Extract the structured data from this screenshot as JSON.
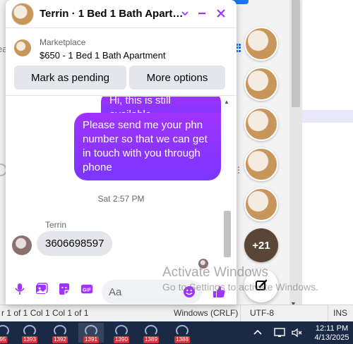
{
  "chat": {
    "title": "Terrin · 1 Bed 1 Bath Apart…",
    "listing": {
      "category": "Marketplace",
      "title": "$650 - 1 Bed 1 Bath Apartment"
    },
    "actions": {
      "mark_pending": "Mark as pending",
      "more_options": "More options"
    },
    "messages": {
      "outgoing_partial": "Hi, this is still available",
      "outgoing": "Please send me your phn number so that we can get in touch with you through phone",
      "timestamp": "Sat 2:57 PM",
      "sender": "Terrin",
      "incoming": "3606698597"
    },
    "composer": {
      "placeholder": "Aa"
    }
  },
  "sidebar": {
    "more_count": "+21"
  },
  "background": {
    "left_text": "ea"
  },
  "statusbar": {
    "left": "r 1 of 1 Col 1 Col 1 of 1",
    "encoding": "Windows (CRLF)",
    "utf": "UTF-8",
    "ins": "INS"
  },
  "taskbar": {
    "items": [
      {
        "badge": "95"
      },
      {
        "badge": "1393"
      },
      {
        "badge": "1392"
      },
      {
        "badge": "1391"
      },
      {
        "badge": "1390"
      },
      {
        "badge": "1389"
      },
      {
        "badge": "1388"
      }
    ],
    "time": "12:11 PM",
    "date": "4/13/2025"
  },
  "watermark": {
    "line1": "Activate Windows",
    "line2": "Go to Settings to activate Windows."
  },
  "colors": {
    "accent": "#a033ff",
    "bubble_gradient_end": "#7b36ff",
    "incoming_bubble": "#e4e6eb",
    "taskbar": "#1b2a44"
  }
}
